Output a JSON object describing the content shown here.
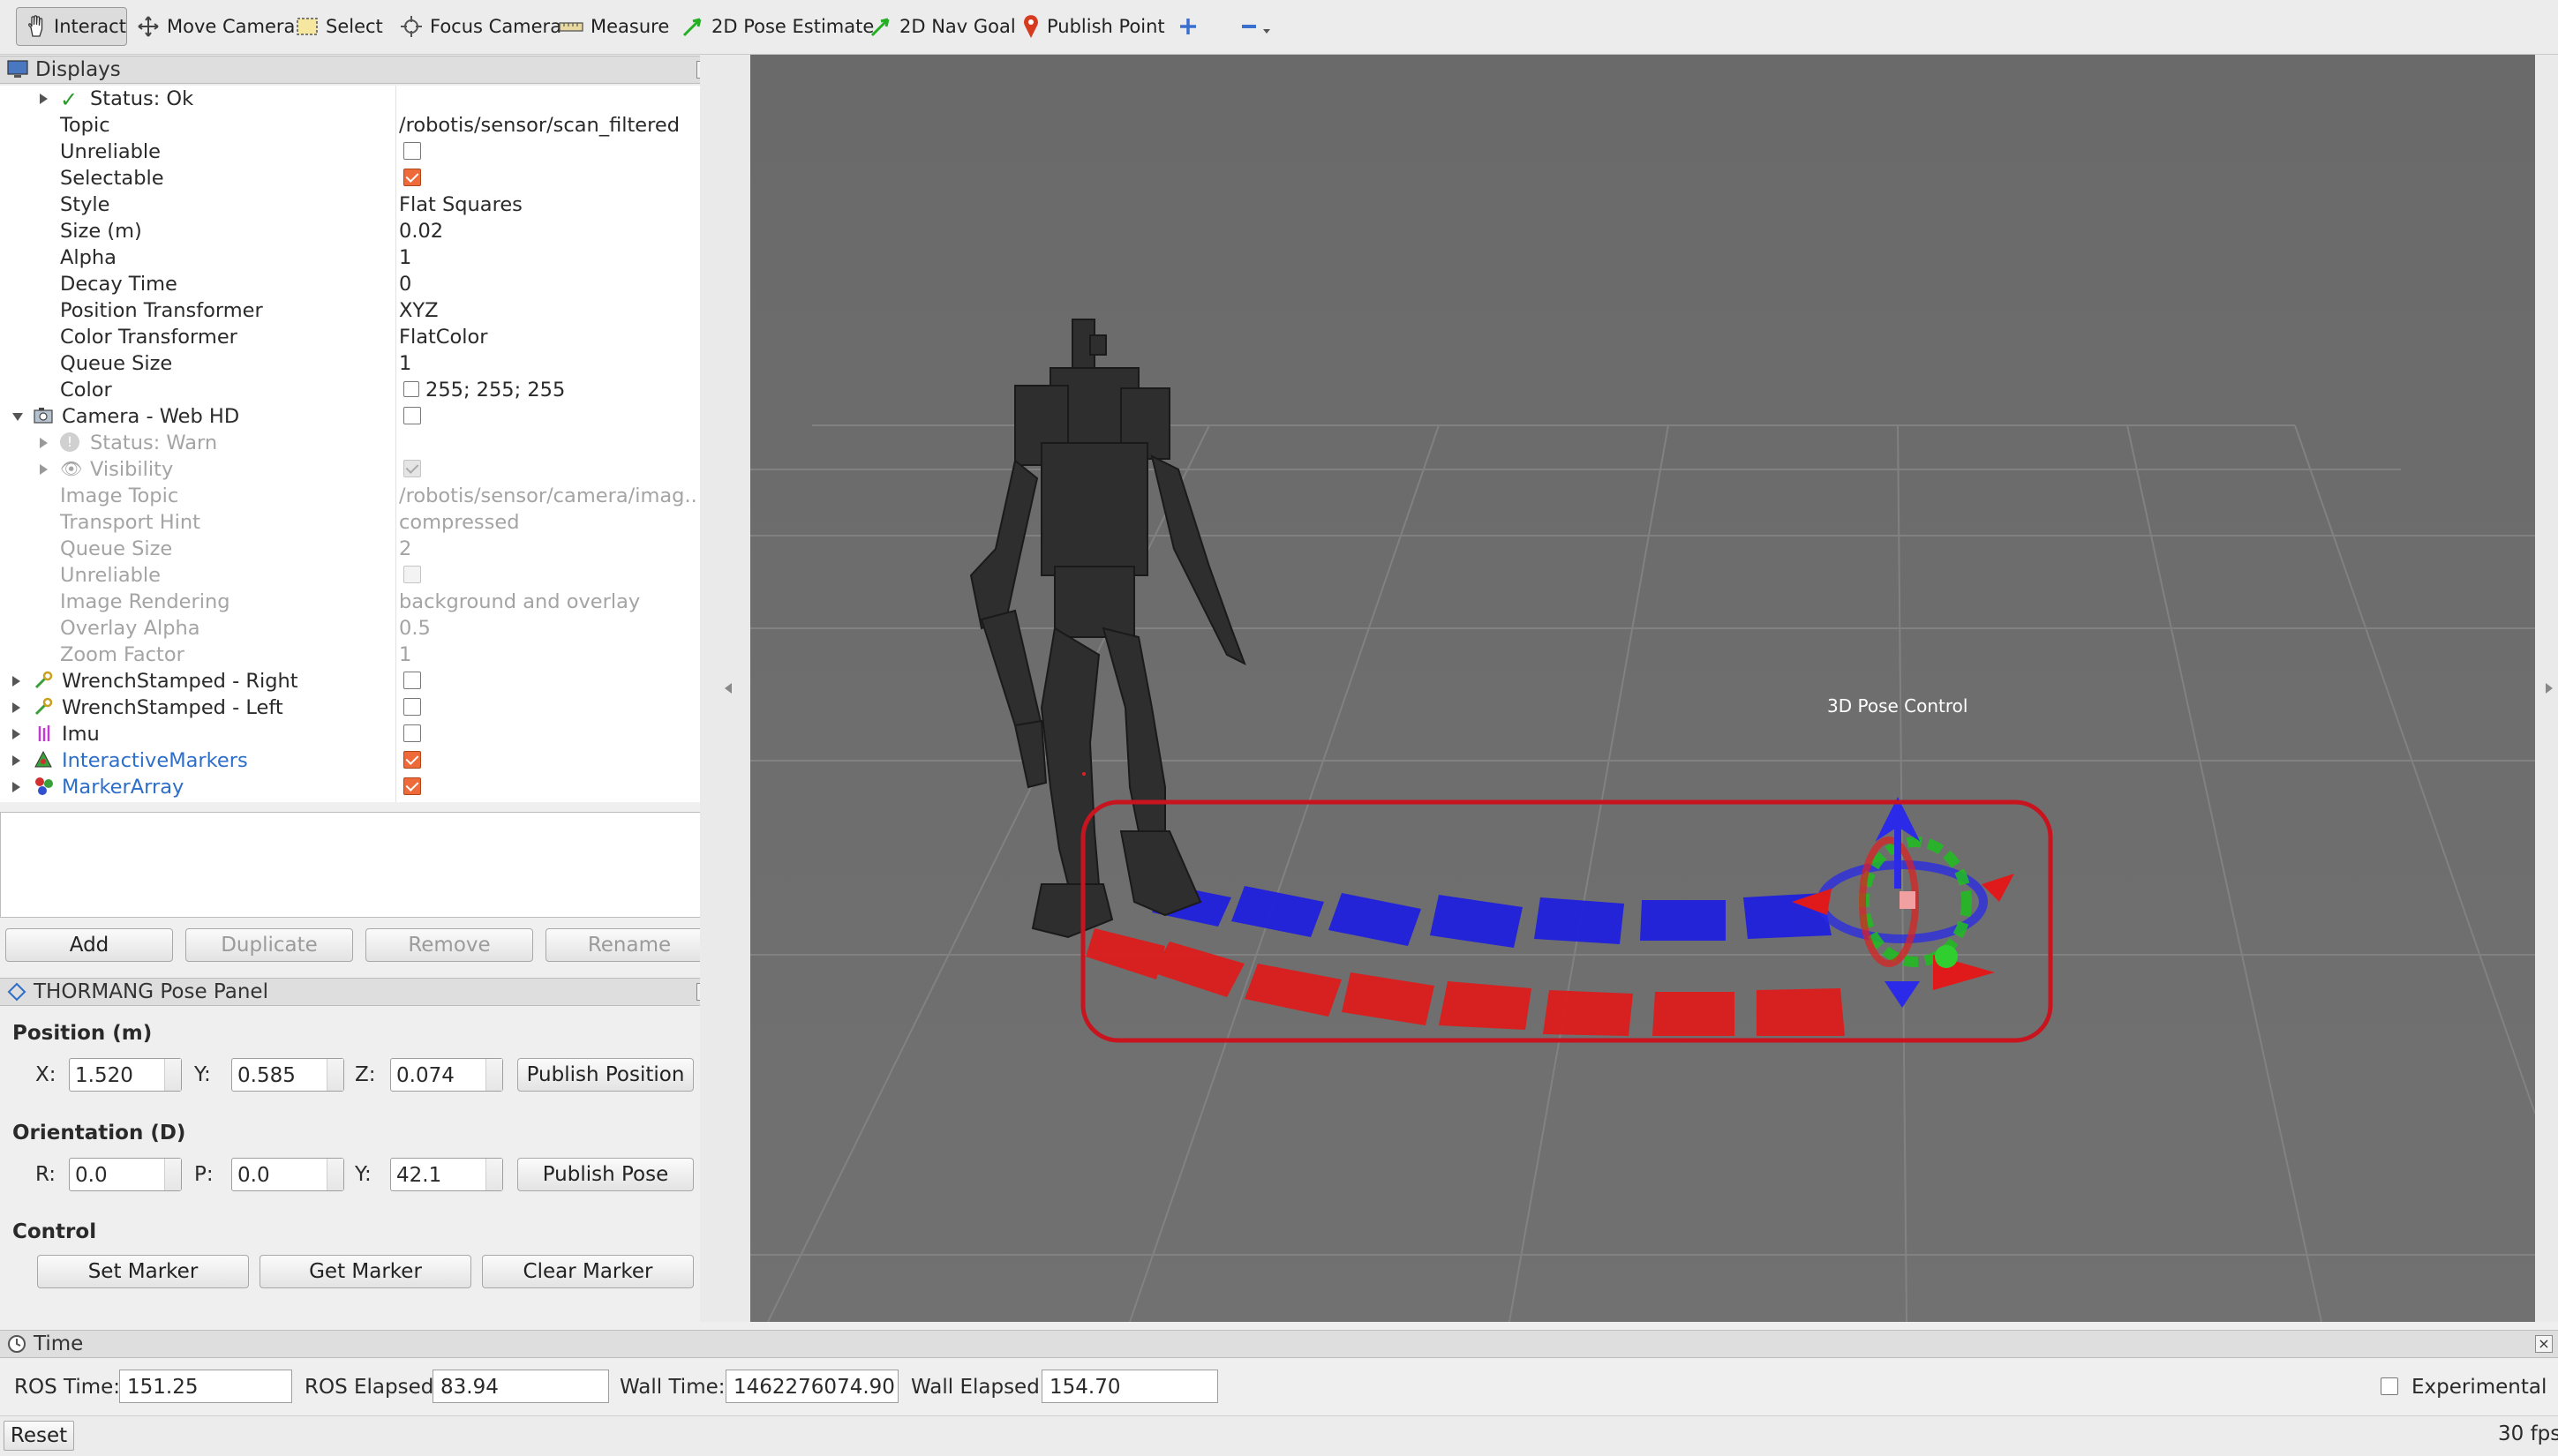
{
  "toolbar": {
    "interact": "Interact",
    "move_camera": "Move Camera",
    "select": "Select",
    "focus_camera": "Focus Camera",
    "measure": "Measure",
    "pose_estimate": "2D Pose Estimate",
    "nav_goal": "2D Nav Goal",
    "publish_point": "Publish Point"
  },
  "displays": {
    "title": "Displays",
    "rows": [
      {
        "name": "Status: Ok",
        "value": ""
      },
      {
        "name": "Topic",
        "value": "/robotis/sensor/scan_filtered"
      },
      {
        "name": "Unreliable",
        "value": ""
      },
      {
        "name": "Selectable",
        "value": ""
      },
      {
        "name": "Style",
        "value": "Flat Squares"
      },
      {
        "name": "Size (m)",
        "value": "0.02"
      },
      {
        "name": "Alpha",
        "value": "1"
      },
      {
        "name": "Decay Time",
        "value": "0"
      },
      {
        "name": "Position Transformer",
        "value": "XYZ"
      },
      {
        "name": "Color Transformer",
        "value": "FlatColor"
      },
      {
        "name": "Queue Size",
        "value": "1"
      },
      {
        "name": "Color",
        "value": "255; 255; 255"
      },
      {
        "name": "Camera - Web HD",
        "value": ""
      },
      {
        "name": "Status: Warn",
        "value": ""
      },
      {
        "name": "Visibility",
        "value": ""
      },
      {
        "name": "Image Topic",
        "value": "/robotis/sensor/camera/imag..."
      },
      {
        "name": "Transport Hint",
        "value": "compressed"
      },
      {
        "name": "Queue Size",
        "value": "2"
      },
      {
        "name": "Unreliable",
        "value": ""
      },
      {
        "name": "Image Rendering",
        "value": "background and overlay"
      },
      {
        "name": "Overlay Alpha",
        "value": "0.5"
      },
      {
        "name": "Zoom Factor",
        "value": "1"
      },
      {
        "name": "WrenchStamped - Right",
        "value": ""
      },
      {
        "name": "WrenchStamped - Left",
        "value": ""
      },
      {
        "name": "Imu",
        "value": ""
      },
      {
        "name": "InteractiveMarkers",
        "value": ""
      },
      {
        "name": "MarkerArray",
        "value": ""
      }
    ],
    "buttons": {
      "add": "Add",
      "duplicate": "Duplicate",
      "remove": "Remove",
      "rename": "Rename"
    }
  },
  "pose_panel": {
    "title": "THORMANG Pose Panel",
    "position_label": "Position (m)",
    "x_label": "X:",
    "x_value": "1.520",
    "y_label": "Y:",
    "y_value": "0.585",
    "z_label": "Z:",
    "z_value": "0.074",
    "publish_position": "Publish Position",
    "orientation_label": "Orientation (D)",
    "r_label": "R:",
    "r_value": "0.0",
    "p_label": "P:",
    "p_value": "0.0",
    "yaw_label": "Y:",
    "yaw_value": "42.1",
    "publish_pose": "Publish Pose",
    "control_label": "Control",
    "set_marker": "Set Marker",
    "get_marker": "Get Marker",
    "clear_marker": "Clear Marker"
  },
  "viewport": {
    "marker_label": "3D  Pose  Control"
  },
  "time_panel": {
    "title": "Time",
    "ros_time_label": "ROS Time:",
    "ros_time": "151.25",
    "ros_elapsed_label": "ROS Elapsed:",
    "ros_elapsed": "83.94",
    "wall_time_label": "Wall Time:",
    "wall_time": "1462276074.90",
    "wall_elapsed_label": "Wall Elapsed:",
    "wall_elapsed": "154.70",
    "experimental": "Experimental"
  },
  "status_bar": {
    "reset": "Reset",
    "fps": "30 fps"
  },
  "colors": {
    "viewport_bg": "#6c6c6c",
    "link_blue": "#2d6ec9",
    "checkbox_on": "#ee6a3a",
    "footstep_red": "#e01a1a",
    "footstep_blue": "#2020e0",
    "highlight_ring": "#c8141e"
  }
}
